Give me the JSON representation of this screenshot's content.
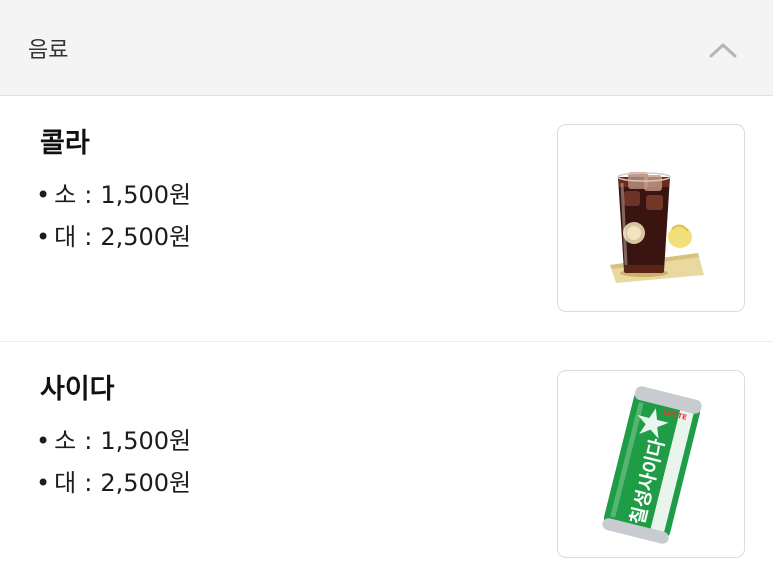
{
  "section": {
    "title": "음료",
    "toggle_icon": "chevron-up-icon"
  },
  "items": [
    {
      "name": "콜라",
      "prices": [
        {
          "bullet": "•",
          "size": "소",
          "separator": ":",
          "price": "1,500원"
        },
        {
          "bullet": "•",
          "size": "대",
          "separator": ":",
          "price": "2,500원"
        }
      ],
      "image_icon": "iced-cola-glass-image"
    },
    {
      "name": "사이다",
      "prices": [
        {
          "bullet": "•",
          "size": "소",
          "separator": ":",
          "price": "1,500원"
        },
        {
          "bullet": "•",
          "size": "대",
          "separator": ":",
          "price": "2,500원"
        }
      ],
      "image_icon": "cider-can-image",
      "can": {
        "brand": "LOTTE",
        "label": "칠성사이다"
      }
    }
  ],
  "colors": {
    "header_bg": "#f4f4f4",
    "divider": "#e2e2e2",
    "cider_green": "#1f9c46",
    "cola_brown": "#3a1410"
  }
}
